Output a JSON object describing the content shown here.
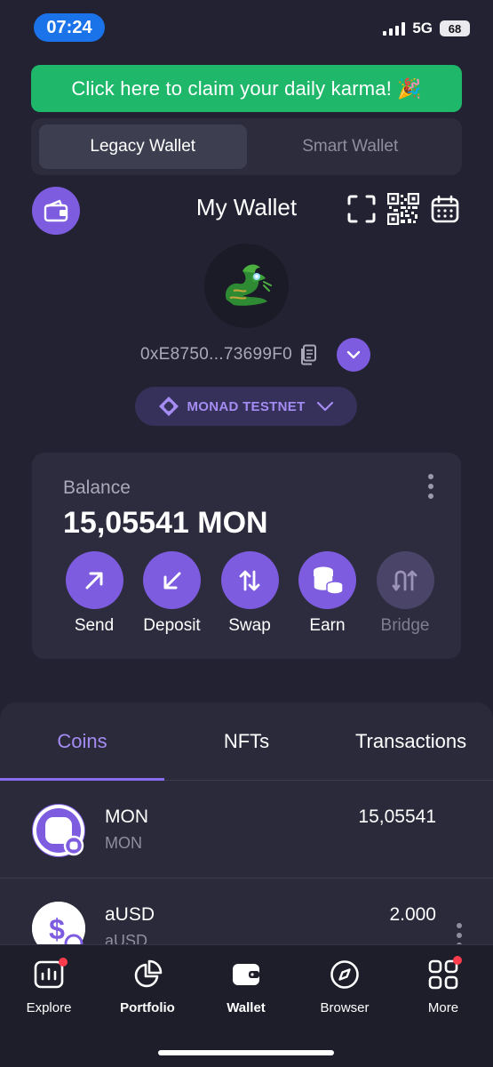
{
  "status_bar": {
    "time": "07:24",
    "network": "5G",
    "battery": "68"
  },
  "karma_banner": {
    "text": "Click here to claim your daily karma!",
    "emoji": "🎉"
  },
  "wallet_toggle": {
    "options": [
      "Legacy Wallet",
      "Smart Wallet"
    ],
    "active": "Legacy Wallet"
  },
  "header": {
    "title": "My Wallet",
    "icons": [
      "wallet-icon",
      "scan-icon",
      "qr-code-icon",
      "calendar-icon"
    ]
  },
  "account": {
    "address": "0xE8750...73699F0",
    "network": "MONAD TESTNET"
  },
  "balance": {
    "label": "Balance",
    "value": "15,05541 MON",
    "actions": [
      {
        "label": "Send",
        "icon": "arrow-up-right-icon",
        "enabled": true
      },
      {
        "label": "Deposit",
        "icon": "arrow-down-left-icon",
        "enabled": true
      },
      {
        "label": "Swap",
        "icon": "swap-arrows-icon",
        "enabled": true
      },
      {
        "label": "Earn",
        "icon": "coins-stack-icon",
        "enabled": true
      },
      {
        "label": "Bridge",
        "icon": "bridge-arrows-icon",
        "enabled": false
      }
    ]
  },
  "assets": {
    "tabs": [
      "Coins",
      "NFTs",
      "Transactions"
    ],
    "active_tab": "Coins",
    "coins": [
      {
        "name": "MON",
        "symbol": "MON",
        "amount": "15,05541"
      },
      {
        "name": "aUSD",
        "symbol": "aUSD",
        "amount": "2.000"
      }
    ]
  },
  "tabbar": {
    "items": [
      {
        "label": "Explore",
        "icon": "explore-chart-icon",
        "badge": true
      },
      {
        "label": "Portfolio",
        "icon": "pie-chart-icon",
        "badge": false
      },
      {
        "label": "Wallet",
        "icon": "wallet-icon",
        "badge": false
      },
      {
        "label": "Browser",
        "icon": "compass-icon",
        "badge": false
      },
      {
        "label": "More",
        "icon": "grid-icon",
        "badge": true
      }
    ]
  },
  "colors": {
    "accent": "#7d5ce0",
    "banner": "#1fb86b",
    "background": "#232232",
    "badge": "#ff3b4e"
  }
}
